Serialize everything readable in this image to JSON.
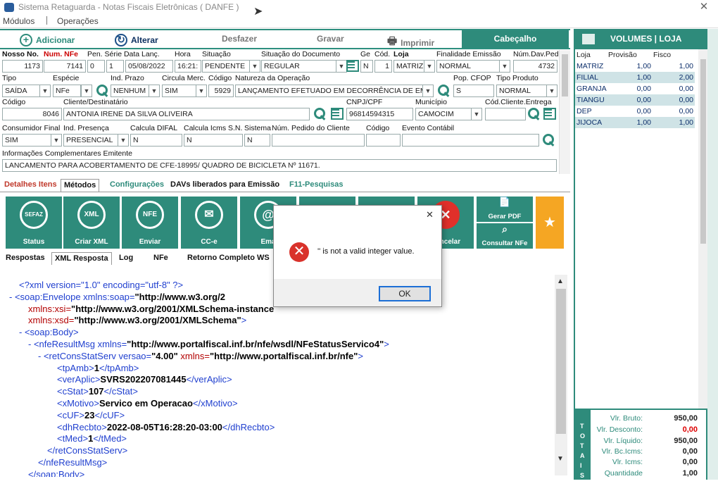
{
  "window": {
    "title": "Sistema Retaguarda - Notas Fiscais Eletrônicas ( DANFE )"
  },
  "menu": [
    "Módulos",
    "Operações"
  ],
  "toolbar": {
    "add": "Adicionar",
    "edit": "Alterar",
    "undo": "Desfazer",
    "save": "Gravar",
    "print": "Imprimir",
    "header": "Cabeçalho",
    "volumes": "VOLUMES | LOJA"
  },
  "form": {
    "row1_labels": {
      "nosso": "Nosso No.",
      "nfe": "Num. NFe",
      "serie": "Pen. Série Data Lanç.",
      "hora": "Hora",
      "situacao": "Situação",
      "sitdoc": "Situação do Documento",
      "ge": "Ge",
      "cod": "Cód.",
      "loja": "Loja",
      "finalidade": "Finalidade Emissão",
      "numdav": "Núm.Dav.Ped"
    },
    "row1": {
      "nosso": "1173",
      "nfe": "7141",
      "pen": "0",
      "serie": "1",
      "data": "05/08/2022",
      "hora": "16:21:",
      "situacao": "PENDENTE",
      "sitdoc": "REGULAR",
      "ge": "N",
      "cod": "1",
      "loja": "MATRIZ",
      "finalidade": "NORMAL",
      "numdav": "4732"
    },
    "row2_labels": {
      "tipo": "Tipo",
      "especie": "Espécie",
      "indprazo": "Ind. Prazo",
      "circula": "Circula Merc.",
      "codigo": "Código",
      "natureza": "Natureza da Operação",
      "popcfop": "Pop. CFOP",
      "tipoprod": "Tipo Produto"
    },
    "row2": {
      "tipo": "SAÍDA",
      "especie": "NFe",
      "indprazo": "NENHUM",
      "circula": "SIM",
      "codigo": "5929",
      "natureza": "LANÇAMENTO EFETUADO EM DECORRÊNCIA DE EMISS",
      "popcfop": "S",
      "tipoprod": "NORMAL"
    },
    "row3_labels": {
      "codigo": "Código",
      "cliente": "Cliente/Destinatário",
      "cnpj": "CNPJ/CPF",
      "municipio": "Município",
      "codentrega": "Cód.Cliente.Entrega"
    },
    "row3": {
      "codigo": "8046",
      "cliente": "ANTONIA IRENE DA SILVA OLIVEIRA",
      "cnpj": "96814594315",
      "municipio": "CAMOCIM",
      "codentrega": ""
    },
    "row4_labels": {
      "consumidor": "Consumidor Final",
      "presenca": "Ind. Presença",
      "difal": "Calcula DIFAL",
      "icmssn": "Calcula Icms S.N.",
      "sistema": "Sistema",
      "pedido": "Núm. Pedido do Cliente",
      "codigo": "Código",
      "evento": "Evento Contábil"
    },
    "row4": {
      "consumidor": "SIM",
      "presenca": "PRESENCIAL",
      "difal": "N",
      "icmssn": "N",
      "sistema": "N",
      "pedido": "",
      "codigo": "",
      "evento": ""
    },
    "info_label": "Informações Complementares Emitente",
    "info": "LANCAMENTO PARA ACOBERTAMENTO DE CFE-18995/ QUADRO DE BICICLETA Nº 11671."
  },
  "tabs": [
    "Detalhes Itens",
    "Métodos",
    "Configurações",
    "DAVs liberados para Emissão",
    "F11-Pesquisas"
  ],
  "methods": [
    "Status",
    "Criar XML",
    "Enviar",
    "CC-e",
    "Ema",
    "Cancelar",
    "Gerar PDF",
    "Consultar NFe"
  ],
  "method_icons": {
    "status": "SEFAZ",
    "xml": "XML",
    "nfe": "NFE"
  },
  "subtabs": [
    "Respostas",
    "XML Resposta",
    "Log",
    "NFe",
    "Retorno Completo WS"
  ],
  "xml": {
    "l1": "<?xml version=\"1.0\" encoding=\"utf-8\" ?>",
    "l2a": "- <soap:Envelope xmlns:soap=",
    "l2b": "\"http://www.w3.org/2",
    "l3a": "xmlns:xsi=",
    "l3b": "\"http://www.w3.org/2001/XMLSchema-instance",
    "l4a": "xmlns:xsd=",
    "l4b": "\"http://www.w3.org/2001/XMLSchema\"",
    ">": ">",
    "l5": "- <soap:Body>",
    "l6a": "- <nfeResultMsg xmlns=",
    "l6b": "\"http://www.portalfiscal.inf.br/nfe/wsdl/NFeStatusServico4\"",
    "l7a": "- <retConsStatServ versao=",
    "l7b": "\"4.00\"",
    "l7c": " xmlns=",
    "l7d": "\"http://www.portalfiscal.inf.br/nfe\"",
    "tpAmb": "1",
    "verAplic": "SVRS202207081445",
    "cStat": "107",
    "xMotivo": "Servico em Operacao",
    "cUF": "23",
    "dhRecbto": "2022-08-05T16:28:20-03:00",
    "tMed": "1",
    "c1": "</retConsStatServ>",
    "c2": "</nfeResultMsg>",
    "c3": "</soap:Body>"
  },
  "dialog": {
    "message": "'' is not a valid integer value.",
    "ok": "OK",
    "close": "✕"
  },
  "stores": {
    "headers": [
      "Loja",
      "Provisão",
      "Fisco"
    ],
    "rows": [
      [
        "MATRIZ",
        "1,00",
        "1,00"
      ],
      [
        "FILIAL",
        "1,00",
        "2,00"
      ],
      [
        "GRANJA",
        "0,00",
        "0,00"
      ],
      [
        "TIANGU",
        "0,00",
        "0,00"
      ],
      [
        "DEP",
        "0,00",
        "0,00"
      ],
      [
        "JIJOCA",
        "1,00",
        "1,00"
      ]
    ]
  },
  "totals": {
    "side": "TOTAIS",
    "bruto_l": "Vlr. Bruto:",
    "bruto": "950,00",
    "desc_l": "Vlr. Desconto:",
    "desc": "0,00",
    "liq_l": "Vlr. Líquido:",
    "liq": "950,00",
    "bc_l": "Vlr. Bc.Icms:",
    "bc": "0,00",
    "icms_l": "Vlr. Icms:",
    "icms": "0,00",
    "qtd_l": "Quantidade",
    "qtd": "1,00"
  }
}
